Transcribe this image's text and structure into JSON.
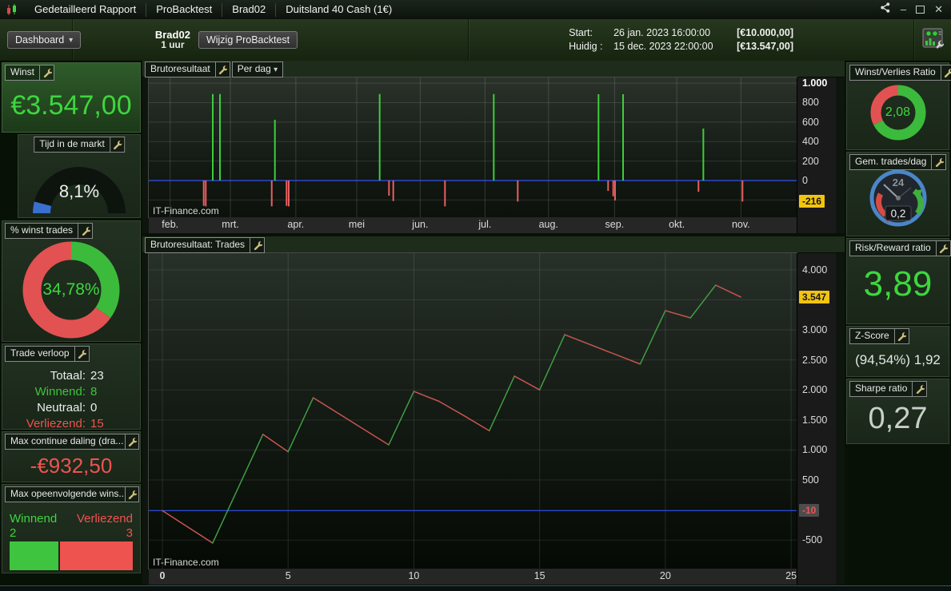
{
  "titlebar": {
    "tabs": [
      "Gedetailleerd Rapport",
      "ProBacktest",
      "Brad02",
      "Duitsland 40 Cash (1€)"
    ],
    "controls": {
      "minimize": "–",
      "close": "✕"
    },
    "icons": {
      "app": "candlestick-chart",
      "share": "share-network",
      "maximize": "maximize-box"
    }
  },
  "toolbar": {
    "dashboard_button": "Dashboard",
    "caret": "▾",
    "system_name": "Brad02",
    "timeframe": "1 uur",
    "edit_button": "Wijzig ProBacktest",
    "start_label": "Start:",
    "start_datetime": "26 jan. 2023 16:00:00",
    "start_amount": "[€10.000,00]",
    "current_label": "Huidig :",
    "current_datetime": "15 dec. 2023 22:00:00",
    "current_amount": "[€13.547,00]"
  },
  "left_panels": {
    "winst": {
      "title": "Winst",
      "value": "€3.547,00",
      "color": "#3ed63e"
    },
    "tijd_in_de_markt": {
      "title": "Tijd in de markt",
      "value": "8,1%",
      "percent": 8.1,
      "arc_color": "#3a6fd0"
    },
    "pct_winst_trades": {
      "title": "% winst trades",
      "value": "34,78%",
      "percent": 34.78,
      "win_color": "#3cba3c",
      "loss_color": "#e25252"
    },
    "trade_verloop": {
      "title": "Trade verloop",
      "rows": [
        {
          "label": "Totaal:",
          "value": "23",
          "color": "#eaeeea"
        },
        {
          "label": "Winnend:",
          "value": "8",
          "color": "#3ec43e"
        },
        {
          "label": "Neutraal:",
          "value": "0",
          "color": "#eaeeea"
        },
        {
          "label": "Verliezend:",
          "value": "15",
          "color": "#ef5350"
        }
      ]
    },
    "max_daling": {
      "title": "Max continue daling (dra...",
      "value": "-€932,50",
      "color": "#ef5350"
    },
    "max_opeenvolgend": {
      "title": "Max opeenvolgende wins...",
      "win_label": "Winnend",
      "win_value": "2",
      "win_count": 2,
      "loss_label": "Verliezend",
      "loss_value": "3",
      "loss_count": 3
    }
  },
  "right_panels": {
    "winst_verlies_ratio": {
      "title": "Winst/Verlies Ratio",
      "value": "2,08",
      "ratio": 2.08,
      "win_color": "#3cba3c",
      "loss_color": "#e25252"
    },
    "gem_trades_dag": {
      "title": "Gem. trades/dag",
      "value": "0,2",
      "dial_top_label": "24"
    },
    "risk_reward": {
      "title": "Risk/Reward ratio",
      "value": "3,89",
      "color": "#3ed63e"
    },
    "z_score": {
      "title": "Z-Score",
      "value": "(94,54%) 1,92"
    },
    "sharpe": {
      "title": "Sharpe ratio",
      "value": "0,27"
    }
  },
  "charts": {
    "top_header": {
      "title": "Brutoresultaat",
      "mode": "Per dag"
    },
    "bottom_header": {
      "title": "Brutoresultaat: Trades"
    },
    "watermark": "IT-Finance.com"
  },
  "chart_data": [
    {
      "type": "bar",
      "title": "Brutoresultaat Per dag",
      "x_tick_labels": [
        "feb.",
        "mrt.",
        "apr.",
        "mei",
        "jun.",
        "jul.",
        "aug.",
        "sep.",
        "okt.",
        "nov."
      ],
      "x_tick_fracs": [
        0.033,
        0.126,
        0.227,
        0.321,
        0.419,
        0.519,
        0.617,
        0.719,
        0.815,
        0.914
      ],
      "y_ticks": [
        {
          "v": 1000,
          "label": "1.000",
          "bold": true
        },
        {
          "v": 800,
          "label": "800"
        },
        {
          "v": 600,
          "label": "600"
        },
        {
          "v": 400,
          "label": "400"
        },
        {
          "v": 200,
          "label": "200"
        },
        {
          "v": 0,
          "label": "0"
        }
      ],
      "badges": [
        {
          "v": -216,
          "label": "-216",
          "style": "yellow"
        }
      ],
      "ylim": [
        -377,
        1058
      ],
      "grid_values": [
        -200,
        200,
        400,
        600,
        800,
        1000
      ],
      "zero_value": 0,
      "zero_line_color": "#2f4cdc",
      "bar_color_up": "#3ccf3c",
      "bar_color_down": "#e86060",
      "bars": [
        {
          "x": 0.0848,
          "v": -260
        },
        {
          "x": 0.088,
          "v": -265
        },
        {
          "x": 0.0988,
          "v": 888
        },
        {
          "x": 0.1099,
          "v": 888
        },
        {
          "x": 0.1898,
          "v": -265
        },
        {
          "x": 0.1947,
          "v": 623
        },
        {
          "x": 0.2127,
          "v": -260
        },
        {
          "x": 0.216,
          "v": -265
        },
        {
          "x": 0.3564,
          "v": 888
        },
        {
          "x": 0.3708,
          "v": -156
        },
        {
          "x": 0.3774,
          "v": -211
        },
        {
          "x": 0.4572,
          "v": -265
        },
        {
          "x": 0.5325,
          "v": 888
        },
        {
          "x": 0.5695,
          "v": -216
        },
        {
          "x": 0.6942,
          "v": 886
        },
        {
          "x": 0.709,
          "v": -107
        },
        {
          "x": 0.7169,
          "v": -162
        },
        {
          "x": 0.7197,
          "v": -205
        },
        {
          "x": 0.7321,
          "v": 886
        },
        {
          "x": 0.8485,
          "v": -115
        },
        {
          "x": 0.856,
          "v": 533
        },
        {
          "x": 0.9164,
          "v": -216
        }
      ]
    },
    {
      "type": "line",
      "title": "Brutoresultaat: Trades",
      "x_ticks": [
        {
          "v": 0,
          "label": "0",
          "bold": true
        },
        {
          "v": 5,
          "label": "5"
        },
        {
          "v": 10,
          "label": "10"
        },
        {
          "v": 15,
          "label": "15"
        },
        {
          "v": 20,
          "label": "20"
        },
        {
          "v": 25,
          "label": "25"
        }
      ],
      "y_ticks": [
        {
          "v": 4000,
          "label": "4.000"
        },
        {
          "v": 3000,
          "label": "3.000"
        },
        {
          "v": 2500,
          "label": "2.500"
        },
        {
          "v": 2000,
          "label": "2.000"
        },
        {
          "v": 1500,
          "label": "1.500"
        },
        {
          "v": 1000,
          "label": "1.000"
        },
        {
          "v": 500,
          "label": "500"
        },
        {
          "v": -500,
          "label": "-500"
        }
      ],
      "badges": [
        {
          "v": 3547,
          "label": "3.547",
          "style": "yellow"
        },
        {
          "v": -10,
          "label": "-10",
          "style": "grey-red"
        }
      ],
      "xlim": [
        -0.54,
        25.22
      ],
      "ylim": [
        -976,
        4277
      ],
      "grid_values": [
        -500,
        500,
        1000,
        1500,
        2000,
        2500,
        3000,
        3500,
        4000
      ],
      "zero_value": -10,
      "zero_line_color": "#2f4cdc",
      "up_color": "#3f9e42",
      "down_color": "#c85450",
      "points": [
        [
          0,
          -10
        ],
        [
          2,
          -550
        ],
        [
          4,
          1260
        ],
        [
          5,
          970
        ],
        [
          6,
          1870
        ],
        [
          9,
          1085
        ],
        [
          10,
          1975
        ],
        [
          11,
          1810
        ],
        [
          12,
          1570
        ],
        [
          13,
          1320
        ],
        [
          14,
          2230
        ],
        [
          15,
          2000
        ],
        [
          16,
          2920
        ],
        [
          19,
          2430
        ],
        [
          20,
          3320
        ],
        [
          21,
          3200
        ],
        [
          22,
          3745
        ],
        [
          23,
          3547
        ]
      ]
    }
  ]
}
